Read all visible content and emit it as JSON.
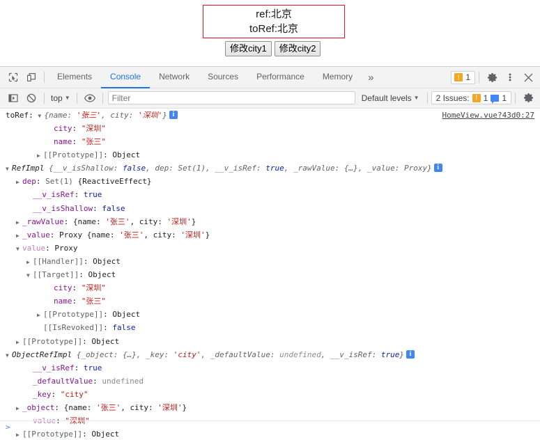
{
  "app": {
    "ref_line": "ref:北京",
    "toref_line": "toRef:北京",
    "buttons": [
      {
        "label": "修改city1"
      },
      {
        "label": "修改city2"
      }
    ]
  },
  "devtools": {
    "toolbar": {
      "inspect_icon": "inspect-element-icon",
      "device_icon": "device-toolbar-icon",
      "tabs": [
        {
          "label": "Elements",
          "active": false
        },
        {
          "label": "Console",
          "active": true
        },
        {
          "label": "Network",
          "active": false
        },
        {
          "label": "Sources",
          "active": false
        },
        {
          "label": "Performance",
          "active": false
        },
        {
          "label": "Memory",
          "active": false
        }
      ],
      "more_tabs_label": "»",
      "warning_count": "1",
      "settings_icon": "gear-icon",
      "more_icon": "kebab-menu-icon",
      "close_icon": "close-icon"
    },
    "filterbar": {
      "sidebar_icon": "console-sidebar-icon",
      "clear_icon": "clear-console-icon",
      "context": "top",
      "eye_icon": "live-expression-icon",
      "filter_placeholder": "Filter",
      "filter_value": "",
      "levels": "Default levels",
      "issues_label": "2 Issues:",
      "issues_warning_count": "1",
      "issues_info_count": "1",
      "settings_icon": "console-settings-gear-icon"
    },
    "console": {
      "source_link": "HomeView.vue?43d0:27",
      "prompt": ">",
      "rows": [
        {
          "indent": 0,
          "arrow": "none",
          "parts": [
            {
              "cls": "k-label",
              "text": "toRef: "
            },
            {
              "cls": "arrow-open"
            },
            {
              "cls": "k-prev",
              "text": "{name: "
            },
            {
              "cls": "k-prevstr",
              "text": "'张三'"
            },
            {
              "cls": "k-prev",
              "text": ", city: "
            },
            {
              "cls": "k-prevstr",
              "text": "'深圳'"
            },
            {
              "cls": "k-prev",
              "text": "}"
            },
            {
              "cls": "info"
            }
          ]
        },
        {
          "indent": 4,
          "arrow": "none",
          "parts": [
            {
              "cls": "k-prop",
              "text": "city"
            },
            {
              "cls": "k-obj",
              "text": ": "
            },
            {
              "cls": "k-str",
              "text": "\"深圳\""
            }
          ]
        },
        {
          "indent": 4,
          "arrow": "none",
          "parts": [
            {
              "cls": "k-prop",
              "text": "name"
            },
            {
              "cls": "k-obj",
              "text": ": "
            },
            {
              "cls": "k-str",
              "text": "\"张三\""
            }
          ]
        },
        {
          "indent": 3,
          "arrow": "closed",
          "parts": [
            {
              "cls": "k-proto",
              "text": "[[Prototype]]"
            },
            {
              "cls": "k-obj",
              "text": ": Object"
            }
          ]
        },
        {
          "indent": 0,
          "arrow": "open",
          "parts": [
            {
              "cls": "k-cls",
              "text": "RefImpl "
            },
            {
              "cls": "k-prev",
              "text": "{__v_isShallow: "
            },
            {
              "cls": "k-prevbool",
              "text": "false"
            },
            {
              "cls": "k-prev",
              "text": ", dep: Set(1), __v_isRef: "
            },
            {
              "cls": "k-prevbool",
              "text": "true"
            },
            {
              "cls": "k-prev",
              "text": ", _rawValue: {…}, _value: Proxy}"
            },
            {
              "cls": "info"
            }
          ]
        },
        {
          "indent": 1,
          "arrow": "closed",
          "parts": [
            {
              "cls": "k-prop",
              "text": "dep"
            },
            {
              "cls": "k-obj",
              "text": ": "
            },
            {
              "cls": "k-dim",
              "text": "Set(1) "
            },
            {
              "cls": "k-obj",
              "text": "{ReactiveEffect}"
            }
          ]
        },
        {
          "indent": 2,
          "arrow": "none",
          "parts": [
            {
              "cls": "k-prop",
              "text": "__v_isRef"
            },
            {
              "cls": "k-obj",
              "text": ": "
            },
            {
              "cls": "k-bool",
              "text": "true"
            }
          ]
        },
        {
          "indent": 2,
          "arrow": "none",
          "parts": [
            {
              "cls": "k-prop",
              "text": "__v_isShallow"
            },
            {
              "cls": "k-obj",
              "text": ": "
            },
            {
              "cls": "k-bool",
              "text": "false"
            }
          ]
        },
        {
          "indent": 1,
          "arrow": "closed",
          "parts": [
            {
              "cls": "k-prop",
              "text": "_rawValue"
            },
            {
              "cls": "k-obj",
              "text": ": {name: "
            },
            {
              "cls": "k-str",
              "text": "'张三'"
            },
            {
              "cls": "k-obj",
              "text": ", city: "
            },
            {
              "cls": "k-str",
              "text": "'深圳'"
            },
            {
              "cls": "k-obj",
              "text": "}"
            }
          ]
        },
        {
          "indent": 1,
          "arrow": "closed",
          "parts": [
            {
              "cls": "k-prop",
              "text": "_value"
            },
            {
              "cls": "k-obj",
              "text": ": Proxy {name: "
            },
            {
              "cls": "k-str",
              "text": "'张三'"
            },
            {
              "cls": "k-obj",
              "text": ", city: "
            },
            {
              "cls": "k-str",
              "text": "'深圳'"
            },
            {
              "cls": "k-obj",
              "text": "}"
            }
          ]
        },
        {
          "indent": 1,
          "arrow": "open",
          "parts": [
            {
              "cls": "k-accessor",
              "text": "value"
            },
            {
              "cls": "k-obj",
              "text": ": Proxy"
            }
          ]
        },
        {
          "indent": 2,
          "arrow": "closed",
          "parts": [
            {
              "cls": "k-proto",
              "text": "[[Handler]]"
            },
            {
              "cls": "k-obj",
              "text": ": Object"
            }
          ]
        },
        {
          "indent": 2,
          "arrow": "open",
          "parts": [
            {
              "cls": "k-proto",
              "text": "[[Target]]"
            },
            {
              "cls": "k-obj",
              "text": ": Object"
            }
          ]
        },
        {
          "indent": 4,
          "arrow": "none",
          "parts": [
            {
              "cls": "k-prop",
              "text": "city"
            },
            {
              "cls": "k-obj",
              "text": ": "
            },
            {
              "cls": "k-str",
              "text": "\"深圳\""
            }
          ]
        },
        {
          "indent": 4,
          "arrow": "none",
          "parts": [
            {
              "cls": "k-prop",
              "text": "name"
            },
            {
              "cls": "k-obj",
              "text": ": "
            },
            {
              "cls": "k-str",
              "text": "\"张三\""
            }
          ]
        },
        {
          "indent": 3,
          "arrow": "closed",
          "parts": [
            {
              "cls": "k-proto",
              "text": "[[Prototype]]"
            },
            {
              "cls": "k-obj",
              "text": ": Object"
            }
          ]
        },
        {
          "indent": 3,
          "arrow": "none",
          "parts": [
            {
              "cls": "k-proto",
              "text": "[[IsRevoked]]"
            },
            {
              "cls": "k-obj",
              "text": ": "
            },
            {
              "cls": "k-bool",
              "text": "false"
            }
          ]
        },
        {
          "indent": 1,
          "arrow": "closed",
          "parts": [
            {
              "cls": "k-proto",
              "text": "[[Prototype]]"
            },
            {
              "cls": "k-obj",
              "text": ": Object"
            }
          ]
        },
        {
          "indent": 0,
          "arrow": "open",
          "parts": [
            {
              "cls": "k-cls",
              "text": "ObjectRefImpl "
            },
            {
              "cls": "k-prev",
              "text": "{_object: {…}, _key: "
            },
            {
              "cls": "k-prevstr",
              "text": "'city'"
            },
            {
              "cls": "k-prev",
              "text": ", _defaultValue: "
            },
            {
              "cls": "k-prevundef",
              "text": "undefined"
            },
            {
              "cls": "k-prev",
              "text": ", __v_isRef: "
            },
            {
              "cls": "k-prevbool",
              "text": "true"
            },
            {
              "cls": "k-prev",
              "text": "}"
            },
            {
              "cls": "info"
            }
          ]
        },
        {
          "indent": 2,
          "arrow": "none",
          "parts": [
            {
              "cls": "k-prop",
              "text": "__v_isRef"
            },
            {
              "cls": "k-obj",
              "text": ": "
            },
            {
              "cls": "k-bool",
              "text": "true"
            }
          ]
        },
        {
          "indent": 2,
          "arrow": "none",
          "parts": [
            {
              "cls": "k-prop",
              "text": "_defaultValue"
            },
            {
              "cls": "k-obj",
              "text": ": "
            },
            {
              "cls": "k-undef",
              "text": "undefined"
            }
          ]
        },
        {
          "indent": 2,
          "arrow": "none",
          "parts": [
            {
              "cls": "k-prop",
              "text": "_key"
            },
            {
              "cls": "k-obj",
              "text": ": "
            },
            {
              "cls": "k-str",
              "text": "\"city\""
            }
          ]
        },
        {
          "indent": 1,
          "arrow": "closed",
          "parts": [
            {
              "cls": "k-prop",
              "text": "_object"
            },
            {
              "cls": "k-obj",
              "text": ": {name: "
            },
            {
              "cls": "k-str",
              "text": "'张三'"
            },
            {
              "cls": "k-obj",
              "text": ", city: "
            },
            {
              "cls": "k-str",
              "text": "'深圳'"
            },
            {
              "cls": "k-obj",
              "text": "}"
            }
          ]
        },
        {
          "indent": 2,
          "arrow": "none",
          "parts": [
            {
              "cls": "k-accessor",
              "text": "value"
            },
            {
              "cls": "k-obj",
              "text": ": "
            },
            {
              "cls": "k-str",
              "text": "\"深圳\""
            }
          ]
        },
        {
          "indent": 1,
          "arrow": "closed",
          "parts": [
            {
              "cls": "k-proto",
              "text": "[[Prototype]]"
            },
            {
              "cls": "k-obj",
              "text": ": Object"
            }
          ]
        }
      ]
    }
  }
}
